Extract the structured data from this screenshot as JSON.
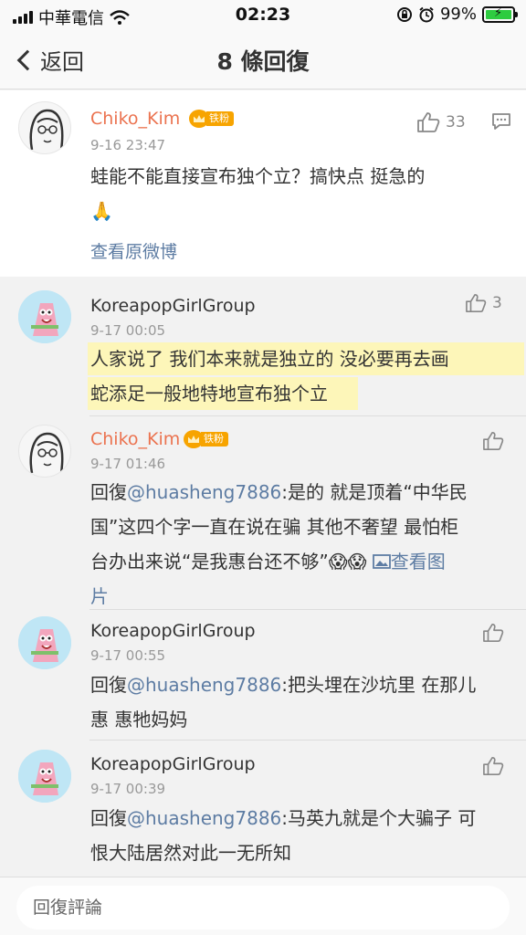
{
  "status_bar": {
    "carrier": "中華電信",
    "time": "02:23",
    "battery": "99%"
  },
  "nav": {
    "back_label": "返回",
    "title": "8 條回復"
  },
  "main_comment": {
    "username": "Chiko_Kim",
    "badge": "铁粉",
    "time": "9-16 23:47",
    "likes": "33",
    "text": "蛙能不能直接宣布独个立？搞快点 挺急的",
    "emoji": "🙏",
    "see_original": "查看原微博"
  },
  "replies": [
    {
      "username": "KoreapopGirlGroup",
      "time": "9-17 00:05",
      "likes": "3",
      "text_line1": "人家说了 我们本来就是独立的 没必要再去画",
      "text_line2": "蛇添足一般地特地宣布独个立"
    },
    {
      "username": "Chiko_Kim",
      "badge": "铁粉",
      "time": "9-17 01:46",
      "reply_prefix": "回復",
      "mention": "@huasheng7886",
      "text_line1": ":是的 就是顶着“中华民",
      "text_line2": "国”这四个字一直在说在骗 其他不奢望 最怕柜",
      "text_line3": "台办出来说“是我惠台还不够”",
      "view_image": "查看图",
      "view_image_cont": "片"
    },
    {
      "username": "KoreapopGirlGroup",
      "time": "9-17 00:55",
      "reply_prefix": "回復",
      "mention": "@huasheng7886",
      "text_line1": ":把头埋在沙坑里 在那儿",
      "text_line2": "惠 惠牠妈妈"
    },
    {
      "username": "KoreapopGirlGroup",
      "time": "9-17 00:39",
      "reply_prefix": "回復",
      "mention": "@huasheng7886",
      "text_line1": ":马英九就是个大骗子 可",
      "text_line2": "恨大陆居然对此一无所知"
    }
  ],
  "input": {
    "placeholder": "回復評論"
  },
  "colors": {
    "username_orange": "#eb7350",
    "link_blue": "#5d7ca3",
    "badge": "#f7a400",
    "battery_green": "#2ecc40"
  }
}
